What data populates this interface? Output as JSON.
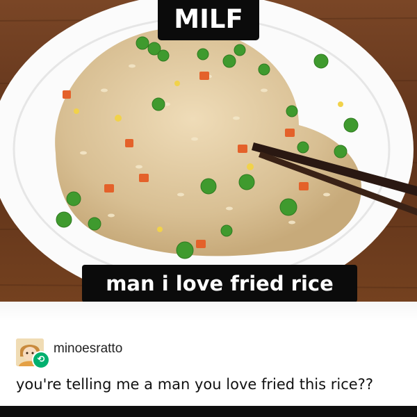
{
  "meme": {
    "top_caption": "MILF",
    "bottom_caption": "man i love fried rice"
  },
  "post": {
    "username": "minoesratto",
    "text": "you're telling me a man you love fried this rice??",
    "reblog_icon": "reblog-icon"
  },
  "colors": {
    "caption_bg": "#0b0b0b",
    "caption_text": "#ffffff",
    "table_wood": "#6b3a1e",
    "plate": "#ffffff",
    "rice": "#dcc49a",
    "peas": "#3f9a2e",
    "carrots": "#e4612a",
    "reblog_badge": "#00b06e"
  }
}
